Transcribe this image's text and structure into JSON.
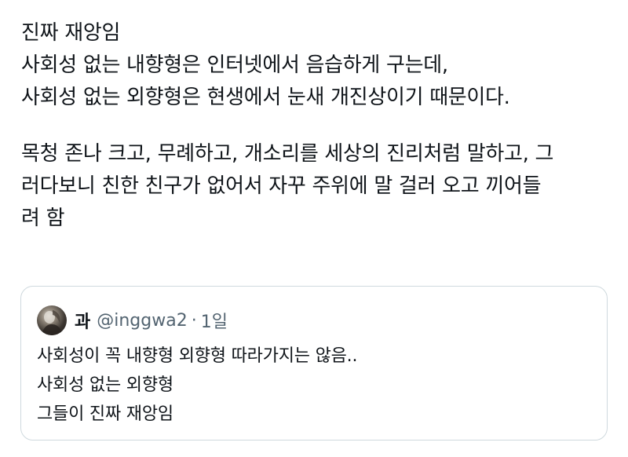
{
  "tweet": {
    "lines": [
      "진짜 재앙임",
      "사회성 없는 내향형은 인터넷에서 음습하게 구는데,",
      "사회성 없는 외향형은 현생에서 눈새 개진상이기 때문이다."
    ],
    "lines2": [
      "목청 존나 크고, 무례하고, 개소리를 세상의 진리처럼 말하고, 그",
      "러다보니 친한 친구가 없어서 자꾸 주위에 말 걸러 오고 끼어들",
      "려 함"
    ]
  },
  "quote": {
    "avatar_icon": "profile-photo",
    "name": "과",
    "handle": "@inggwa2",
    "separator": "·",
    "time": "1일",
    "lines": [
      "사회성이 꼭 내향형 외향형 따라가지는 않음..",
      "사회성 없는 외향형",
      "그들이 진짜 재앙임"
    ]
  },
  "colors": {
    "text": "#0f1419",
    "secondary": "#536471",
    "border": "#cfd9de"
  }
}
